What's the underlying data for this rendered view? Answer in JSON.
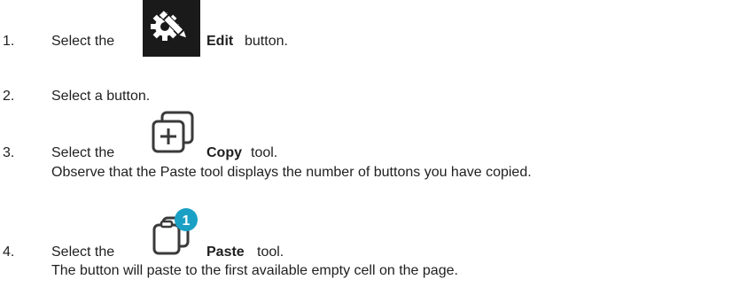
{
  "steps": [
    {
      "number": "1.",
      "before": "Select the",
      "bold": "Edit",
      "after": "button.",
      "icon": "edit-gear-pencil-icon"
    },
    {
      "number": "2.",
      "text": "Select a button."
    },
    {
      "number": "3.",
      "before": "Select the",
      "bold": "Copy",
      "after": "tool.",
      "note": "Observe that the Paste tool displays the number of buttons you have copied.",
      "icon": "copy-plus-icon"
    },
    {
      "number": "4.",
      "before": "Select the",
      "bold": "Paste",
      "after": "tool.",
      "note": "The button will paste to the first available empty cell on the page.",
      "icon": "paste-clipboard-icon",
      "badge": "1"
    }
  ],
  "colors": {
    "text": "#1f1f1f",
    "edit_icon_bg": "#1a1a1a",
    "icon_stroke": "#3a3a3a",
    "badge": "#1aa0c4"
  }
}
